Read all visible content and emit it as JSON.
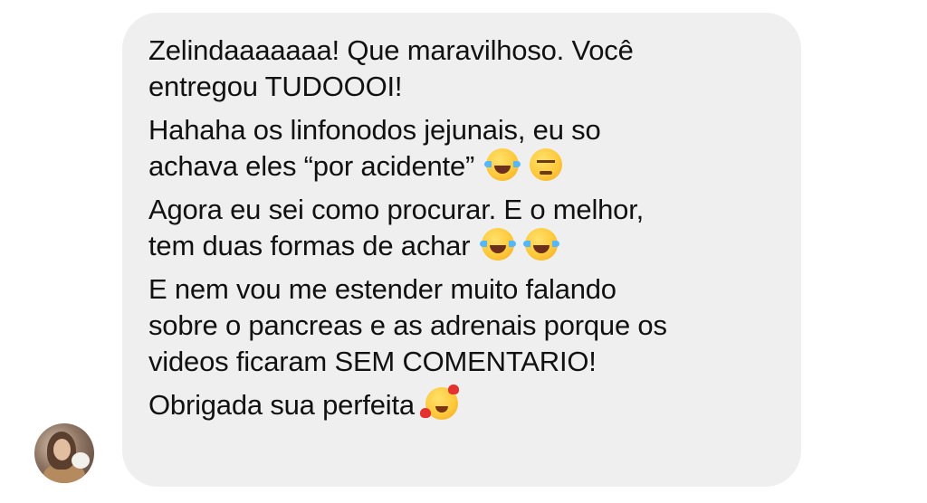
{
  "message": {
    "lines": [
      "Zelindaaaaaaa! Que maravilhoso. Você",
      "entregou TUDOOOI!",
      "Hahaha os linfonodos jejunais, eu so",
      "achava eles “por acidente”",
      "Agora eu sei como procurar. E o melhor,",
      "tem duas formas de achar",
      "E nem vou me estender muito falando",
      "sobre o pancreas e as adrenais porque os",
      "videos ficaram SEM COMENTARIO!",
      "Obrigada sua perfeita"
    ],
    "emojis": {
      "line4": [
        "face-with-tears-of-joy",
        "unamused-face"
      ],
      "line6": [
        "face-with-tears-of-joy",
        "face-with-tears-of-joy"
      ],
      "line10": [
        "smiling-face-with-hearts"
      ]
    }
  },
  "colors": {
    "bubble": "#efeff0",
    "text": "#111111",
    "background": "#ffffff"
  }
}
